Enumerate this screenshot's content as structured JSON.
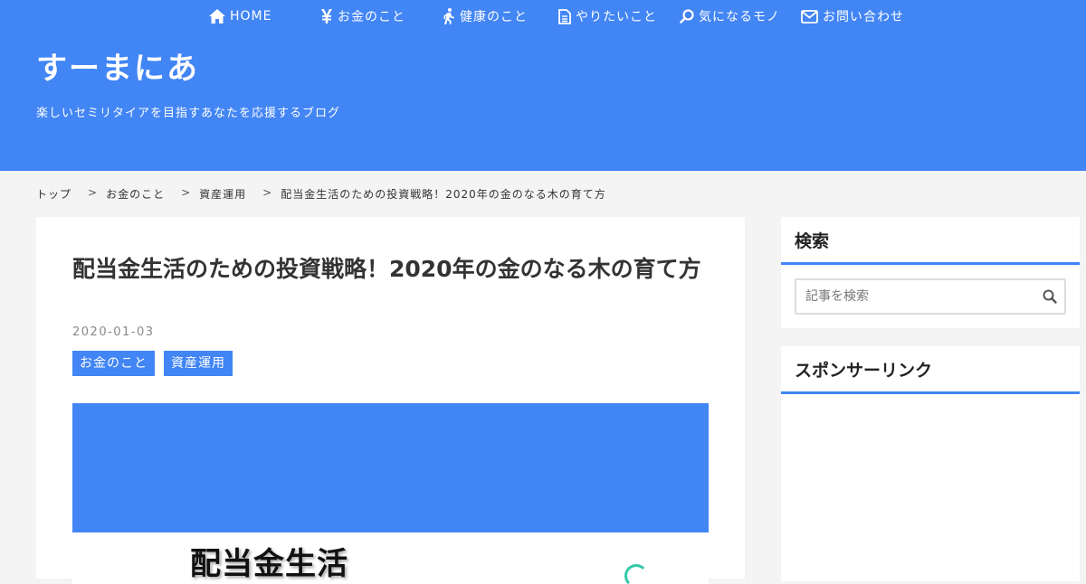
{
  "nav": {
    "items": [
      {
        "label": "HOME",
        "icon": "home-icon"
      },
      {
        "label": "お金のこと",
        "icon": "yen-icon"
      },
      {
        "label": "健康のこと",
        "icon": "walking-icon"
      },
      {
        "label": "やりたいこと",
        "icon": "document-icon"
      },
      {
        "label": "気になるモノ",
        "icon": "search-icon"
      },
      {
        "label": "お問い合わせ",
        "icon": "mail-icon"
      }
    ]
  },
  "site": {
    "title": "すーまにあ",
    "description": "楽しいセミリタイアを目指すあなたを応援するブログ"
  },
  "breadcrumb": [
    "トップ",
    "お金のこと",
    "資産運用",
    "配当金生活のための投資戦略！2020年の金のなる木の育て方"
  ],
  "breadcrumb_separator": ">",
  "post": {
    "title": "配当金生活のための投資戦略！2020年の金のなる木の育て方",
    "date": "2020-01-03",
    "categories": [
      "お金のこと",
      "資産運用"
    ],
    "eyecatch_text": "配当金生活"
  },
  "sidebar": {
    "search": {
      "title": "検索",
      "placeholder": "記事を検索",
      "icon": "search-icon"
    },
    "sponsor": {
      "title": "スポンサーリンク"
    }
  },
  "colors": {
    "accent": "#4285f4",
    "background": "#f4f4f4"
  }
}
